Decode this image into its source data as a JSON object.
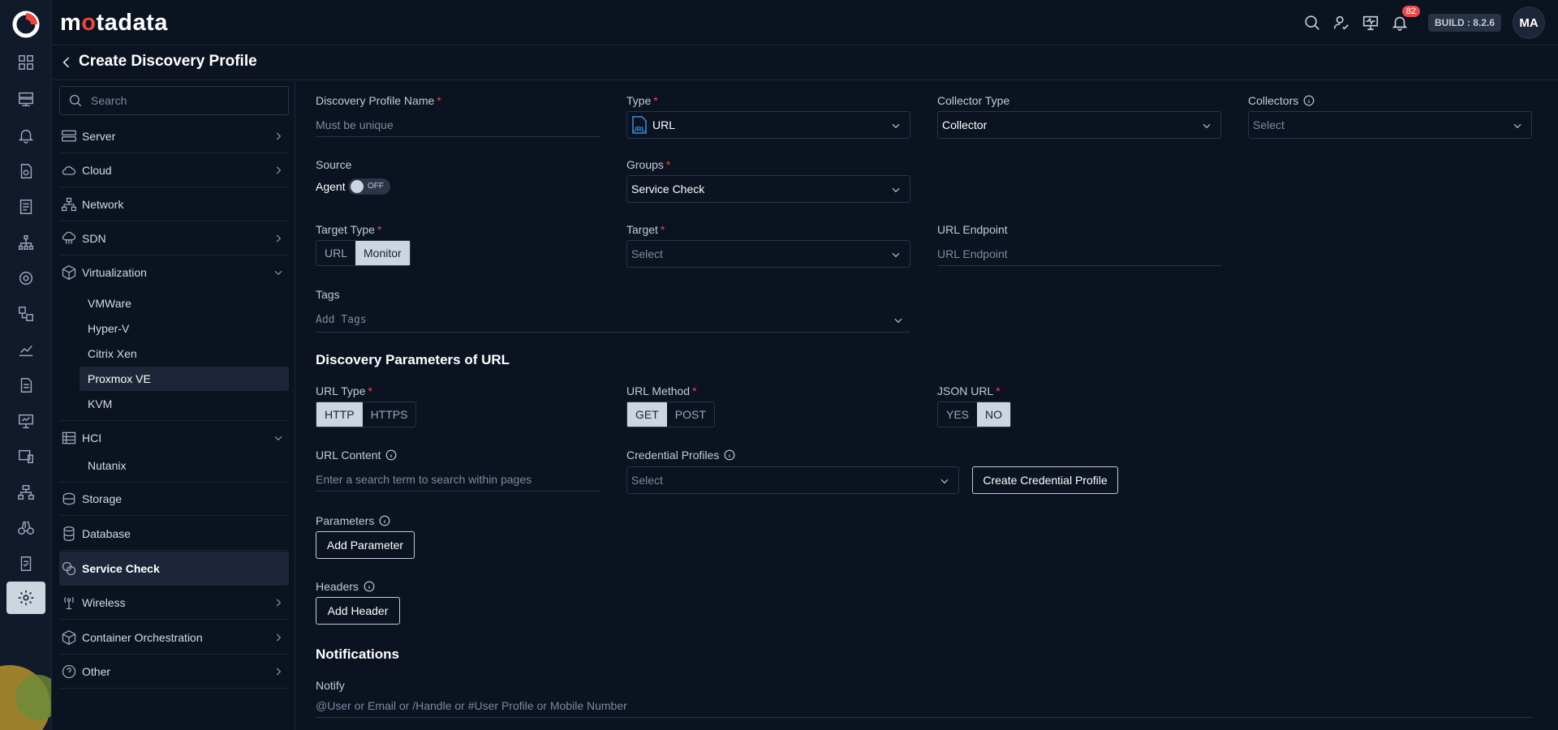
{
  "header": {
    "brand_prefix": "m",
    "brand_o": "o",
    "brand_suffix": "tadata",
    "notification_count": "82",
    "build": "BUILD : 8.2.6",
    "avatar": "MA"
  },
  "page": {
    "title": "Create Discovery Profile"
  },
  "sidebar": {
    "search_placeholder": "Search",
    "items": [
      {
        "label": "Server"
      },
      {
        "label": "Cloud"
      },
      {
        "label": "Network"
      },
      {
        "label": "SDN"
      },
      {
        "label": "Virtualization"
      },
      {
        "label": "HCI"
      },
      {
        "label": "Storage"
      },
      {
        "label": "Database"
      },
      {
        "label": "Service Check"
      },
      {
        "label": "Wireless"
      },
      {
        "label": "Container Orchestration"
      },
      {
        "label": "Other"
      }
    ],
    "virtualization_sub": [
      "VMWare",
      "Hyper-V",
      "Citrix Xen",
      "Proxmox VE",
      "KVM"
    ],
    "hci_sub": [
      "Nutanix"
    ]
  },
  "form": {
    "profile_name_label": "Discovery Profile Name",
    "profile_name_placeholder": "Must be unique",
    "type_label": "Type",
    "type_value": "URL",
    "collector_type_label": "Collector Type",
    "collector_type_value": "Collector",
    "collectors_label": "Collectors",
    "collectors_placeholder": "Select",
    "source_label": "Source",
    "agent_label": "Agent",
    "agent_toggle": "OFF",
    "groups_label": "Groups",
    "groups_value": "Service Check",
    "target_type_label": "Target Type",
    "target_type_options": [
      "URL",
      "Monitor"
    ],
    "target_type_selected": "Monitor",
    "target_label": "Target",
    "target_placeholder": "Select",
    "url_endpoint_label": "URL Endpoint",
    "url_endpoint_placeholder": "URL Endpoint",
    "tags_label": "Tags",
    "tags_placeholder": "Add Tags",
    "params_section": "Discovery Parameters of URL",
    "url_type_label": "URL Type",
    "url_type_options": [
      "HTTP",
      "HTTPS"
    ],
    "url_method_label": "URL Method",
    "url_method_options": [
      "GET",
      "POST"
    ],
    "json_url_label": "JSON URL",
    "json_url_options": [
      "YES",
      "NO"
    ],
    "url_content_label": "URL Content",
    "url_content_placeholder": "Enter a search term to search within pages",
    "credential_profiles_label": "Credential Profiles",
    "credential_profiles_placeholder": "Select",
    "create_credential_button": "Create Credential Profile",
    "parameters_label": "Parameters",
    "add_parameter_button": "Add Parameter",
    "headers_label": "Headers",
    "add_header_button": "Add Header",
    "notifications_section": "Notifications",
    "notify_label": "Notify",
    "notify_placeholder": "@User or Email or /Handle or #User Profile or Mobile Number"
  },
  "colors": {
    "accent": "#e9473a",
    "background": "#0b1220",
    "selected": "#cdd5e0",
    "required": "#e94a4a"
  }
}
